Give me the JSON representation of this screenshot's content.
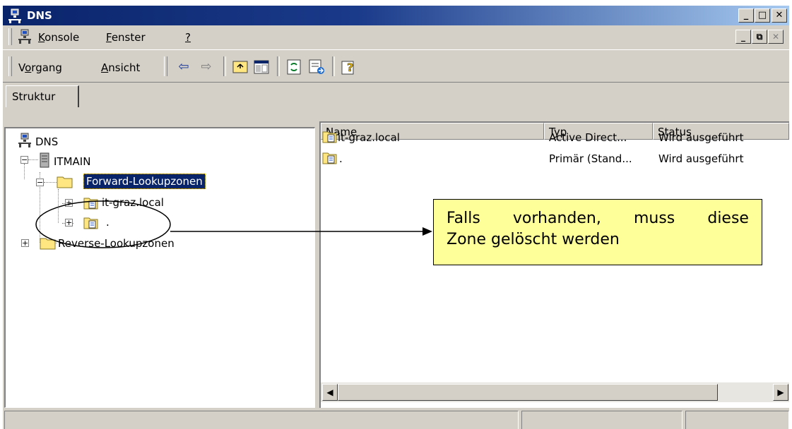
{
  "window": {
    "title": "DNS"
  },
  "caption_buttons": {
    "minimize": "_",
    "maximize": "□",
    "close": "✕"
  },
  "menu": {
    "konsole": {
      "accel": "K",
      "rest": "onsole"
    },
    "fenster": {
      "accel": "F",
      "rest": "enster"
    },
    "help": "?"
  },
  "toolbar": {
    "vorgang_pre": "V",
    "vorgang_accel": "o",
    "vorgang_post": "rgang",
    "ansicht_accel": "A",
    "ansicht_rest": "nsicht"
  },
  "left_tab": "Struktur",
  "tree": {
    "root": "DNS",
    "server": "ITMAIN",
    "forward": "Forward-Lookupzonen",
    "zone1": "it-graz.local",
    "zone2": ".",
    "reverse": "Reverse-Lookupzonen"
  },
  "list": {
    "columns": [
      "Name",
      "Typ",
      "Status"
    ],
    "rows": [
      {
        "name": "it-graz.local",
        "typ": "Active Direct...",
        "status": "Wird ausgeführt"
      },
      {
        "name": ".",
        "typ": "Primär (Stand...",
        "status": "Wird ausgeführt"
      }
    ]
  },
  "callout": {
    "line1_words": [
      "Falls",
      "vorhanden,",
      "muss",
      "diese"
    ],
    "line2": "Zone gelöscht werden",
    "color": "#ffff99"
  },
  "colors": {
    "titlebar": "#0a246a",
    "face": "#d4d0c8",
    "selection": "#0a246a"
  }
}
